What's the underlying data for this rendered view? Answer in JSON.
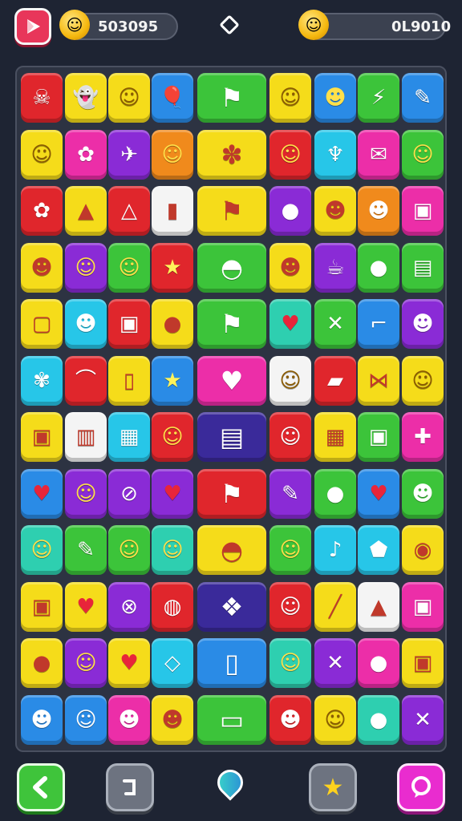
{
  "header": {
    "left_counter": "503095",
    "right_counter": "0L9010",
    "left_coin_icon": "coin-smiley-icon",
    "right_coin_icon": "coin-smiley-icon"
  },
  "colors": {
    "background": "#1e2433",
    "board": "#2d3342",
    "red": "#e0262c",
    "yellow": "#f5dc1a",
    "blue": "#2a8be6",
    "green": "#3cc43a",
    "purple": "#8a2bd6",
    "orange": "#f08a1c",
    "pink": "#ec2ea8",
    "cyan": "#27c6e8",
    "white": "#f4f4f4",
    "navy": "#3a2a9a",
    "teal": "#2ecfb0",
    "lime": "#8ed83a"
  },
  "board": {
    "rows": [
      [
        {
          "color": "red",
          "icon": "skull",
          "glyph": "☠"
        },
        {
          "color": "yellow",
          "icon": "ghost",
          "glyph": "👻"
        },
        {
          "color": "yellow",
          "icon": "smiley",
          "glyph": "☺"
        },
        {
          "color": "blue",
          "icon": "balloon",
          "glyph": "🎈"
        },
        {
          "color": "green",
          "icon": "flag",
          "glyph": "⚑",
          "wide": true
        },
        {
          "color": "yellow",
          "icon": "smiley",
          "glyph": "☺"
        },
        {
          "color": "blue",
          "icon": "face",
          "glyph": "☻"
        },
        {
          "color": "green",
          "icon": "lightning",
          "glyph": "⚡"
        },
        {
          "color": "blue",
          "icon": "brush",
          "glyph": "✎"
        }
      ],
      [
        {
          "color": "yellow",
          "icon": "smiley",
          "glyph": "☺"
        },
        {
          "color": "pink",
          "icon": "crab",
          "glyph": "✿"
        },
        {
          "color": "purple",
          "icon": "wing",
          "glyph": "✈"
        },
        {
          "color": "orange",
          "icon": "smiley",
          "glyph": "☺"
        },
        {
          "color": "yellow",
          "icon": "candy",
          "glyph": "✽",
          "wide": true
        },
        {
          "color": "red",
          "icon": "smiley",
          "glyph": "☺"
        },
        {
          "color": "cyan",
          "icon": "carrot",
          "glyph": "♆"
        },
        {
          "color": "pink",
          "icon": "card",
          "glyph": "✉"
        },
        {
          "color": "green",
          "icon": "smiley",
          "glyph": "☺"
        }
      ],
      [
        {
          "color": "red",
          "icon": "flower",
          "glyph": "✿"
        },
        {
          "color": "yellow",
          "icon": "cone",
          "glyph": "▲"
        },
        {
          "color": "red",
          "icon": "triangle",
          "glyph": "△"
        },
        {
          "color": "white",
          "icon": "bottle",
          "glyph": "▮"
        },
        {
          "color": "yellow",
          "icon": "flag",
          "glyph": "⚑",
          "wide": true
        },
        {
          "color": "purple",
          "icon": "lollipop",
          "glyph": "●"
        },
        {
          "color": "yellow",
          "icon": "pig",
          "glyph": "☻"
        },
        {
          "color": "orange",
          "icon": "bear",
          "glyph": "☻"
        },
        {
          "color": "pink",
          "icon": "bag",
          "glyph": "▣"
        }
      ],
      [
        {
          "color": "yellow",
          "icon": "frog",
          "glyph": "☻"
        },
        {
          "color": "purple",
          "icon": "face",
          "glyph": "☺"
        },
        {
          "color": "green",
          "icon": "smiley",
          "glyph": "☺"
        },
        {
          "color": "red",
          "icon": "star",
          "glyph": "★"
        },
        {
          "color": "green",
          "icon": "lips",
          "glyph": "◓",
          "wide": true
        },
        {
          "color": "yellow",
          "icon": "frog",
          "glyph": "☻"
        },
        {
          "color": "purple",
          "icon": "cup",
          "glyph": "☕"
        },
        {
          "color": "green",
          "icon": "apple",
          "glyph": "●"
        },
        {
          "color": "green",
          "icon": "basket",
          "glyph": "▤"
        }
      ],
      [
        {
          "color": "yellow",
          "icon": "box",
          "glyph": "▢"
        },
        {
          "color": "cyan",
          "icon": "bear",
          "glyph": "☻"
        },
        {
          "color": "red",
          "icon": "jar",
          "glyph": "▣"
        },
        {
          "color": "yellow",
          "icon": "bomb",
          "glyph": "●"
        },
        {
          "color": "green",
          "icon": "flag",
          "glyph": "⚑",
          "wide": true
        },
        {
          "color": "teal",
          "icon": "heart",
          "glyph": "♥"
        },
        {
          "color": "green",
          "icon": "cross",
          "glyph": "✕"
        },
        {
          "color": "blue",
          "icon": "hook",
          "glyph": "⌐"
        },
        {
          "color": "purple",
          "icon": "bear",
          "glyph": "☻"
        }
      ],
      [
        {
          "color": "cyan",
          "icon": "brain",
          "glyph": "✾"
        },
        {
          "color": "red",
          "icon": "rainbow",
          "glyph": "⌒"
        },
        {
          "color": "yellow",
          "icon": "cup",
          "glyph": "▯"
        },
        {
          "color": "blue",
          "icon": "star",
          "glyph": "★"
        },
        {
          "color": "pink",
          "icon": "heart",
          "glyph": "♥",
          "wide": true
        },
        {
          "color": "white",
          "icon": "smiley",
          "glyph": "☺"
        },
        {
          "color": "red",
          "icon": "card",
          "glyph": "▰"
        },
        {
          "color": "yellow",
          "icon": "bow",
          "glyph": "⋈"
        },
        {
          "color": "yellow",
          "icon": "smiley",
          "glyph": "☺"
        }
      ],
      [
        {
          "color": "yellow",
          "icon": "bag",
          "glyph": "▣"
        },
        {
          "color": "white",
          "icon": "lantern",
          "glyph": "▥"
        },
        {
          "color": "cyan",
          "icon": "calculator",
          "glyph": "▦"
        },
        {
          "color": "red",
          "icon": "smiley",
          "glyph": "☺"
        },
        {
          "color": "navy",
          "icon": "radio",
          "glyph": "▤",
          "wide": true
        },
        {
          "color": "red",
          "icon": "girl",
          "glyph": "☺"
        },
        {
          "color": "yellow",
          "icon": "calendar",
          "glyph": "▦"
        },
        {
          "color": "green",
          "icon": "bag",
          "glyph": "▣"
        },
        {
          "color": "pink",
          "icon": "pin",
          "glyph": "✚"
        }
      ],
      [
        {
          "color": "blue",
          "icon": "heart",
          "glyph": "♥"
        },
        {
          "color": "purple",
          "icon": "smiley",
          "glyph": "☺"
        },
        {
          "color": "purple",
          "icon": "bandage",
          "glyph": "⊘"
        },
        {
          "color": "purple",
          "icon": "heart",
          "glyph": "♥"
        },
        {
          "color": "red",
          "icon": "flag",
          "glyph": "⚑",
          "wide": true
        },
        {
          "color": "purple",
          "icon": "brush",
          "glyph": "✎"
        },
        {
          "color": "green",
          "icon": "fish",
          "glyph": "●"
        },
        {
          "color": "blue",
          "icon": "heart",
          "glyph": "♥"
        },
        {
          "color": "green",
          "icon": "bear",
          "glyph": "☻"
        }
      ],
      [
        {
          "color": "teal",
          "icon": "smiley",
          "glyph": "☺"
        },
        {
          "color": "green",
          "icon": "needle",
          "glyph": "✎"
        },
        {
          "color": "green",
          "icon": "smiley",
          "glyph": "☺"
        },
        {
          "color": "teal",
          "icon": "smiley",
          "glyph": "☺"
        },
        {
          "color": "yellow",
          "icon": "lips",
          "glyph": "◓",
          "wide": true
        },
        {
          "color": "green",
          "icon": "smiley",
          "glyph": "☺"
        },
        {
          "color": "cyan",
          "icon": "guitar",
          "glyph": "♪"
        },
        {
          "color": "cyan",
          "icon": "shield",
          "glyph": "⬟"
        },
        {
          "color": "yellow",
          "icon": "pot",
          "glyph": "◉"
        }
      ],
      [
        {
          "color": "yellow",
          "icon": "bag",
          "glyph": "▣"
        },
        {
          "color": "yellow",
          "icon": "heart",
          "glyph": "♥"
        },
        {
          "color": "purple",
          "icon": "mask",
          "glyph": "⊗"
        },
        {
          "color": "red",
          "icon": "ball",
          "glyph": "◍"
        },
        {
          "color": "navy",
          "icon": "gift",
          "glyph": "❖",
          "wide": true
        },
        {
          "color": "red",
          "icon": "ghost",
          "glyph": "☺"
        },
        {
          "color": "yellow",
          "icon": "pencil",
          "glyph": "╱"
        },
        {
          "color": "white",
          "icon": "cone",
          "glyph": "▲"
        },
        {
          "color": "pink",
          "icon": "bag",
          "glyph": "▣"
        }
      ],
      [
        {
          "color": "yellow",
          "icon": "apple",
          "glyph": "●"
        },
        {
          "color": "purple",
          "icon": "face",
          "glyph": "☺"
        },
        {
          "color": "yellow",
          "icon": "heart",
          "glyph": "♥"
        },
        {
          "color": "cyan",
          "icon": "soap",
          "glyph": "◇"
        },
        {
          "color": "blue",
          "icon": "cup",
          "glyph": "▯",
          "wide": true
        },
        {
          "color": "teal",
          "icon": "smiley",
          "glyph": "☺"
        },
        {
          "color": "purple",
          "icon": "cross",
          "glyph": "✕"
        },
        {
          "color": "pink",
          "icon": "apple",
          "glyph": "●"
        },
        {
          "color": "yellow",
          "icon": "jar",
          "glyph": "▣"
        }
      ],
      [
        {
          "color": "blue",
          "icon": "bear",
          "glyph": "☻"
        },
        {
          "color": "blue",
          "icon": "ghost",
          "glyph": "☺"
        },
        {
          "color": "pink",
          "icon": "cat",
          "glyph": "☻"
        },
        {
          "color": "yellow",
          "icon": "pig",
          "glyph": "☻"
        },
        {
          "color": "green",
          "icon": "label",
          "glyph": "▭",
          "wide": true
        },
        {
          "color": "red",
          "icon": "monkey",
          "glyph": "☻"
        },
        {
          "color": "yellow",
          "icon": "smiley",
          "glyph": "☺"
        },
        {
          "color": "teal",
          "icon": "apple",
          "glyph": "●"
        },
        {
          "color": "purple",
          "icon": "cross",
          "glyph": "✕"
        }
      ]
    ]
  },
  "footer": {
    "back_icon": "chevron-left-icon",
    "undo_icon": "undo-icon",
    "map_icon": "map-pin-icon",
    "star_icon": "star-icon",
    "chat_icon": "chat-bubble-icon"
  }
}
